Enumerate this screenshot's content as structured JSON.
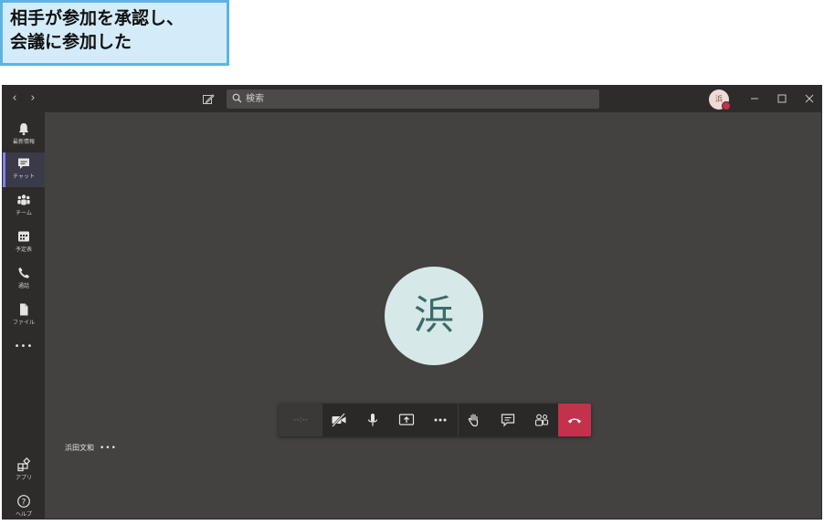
{
  "callout": {
    "line1": "相手が参加を承認し、",
    "line2": "会議に参加した"
  },
  "titlebar": {
    "back_icon": "‹",
    "forward_icon": "›",
    "search_placeholder": "検索",
    "avatar_initial": "浜",
    "status_color": "#c4314b"
  },
  "rail": {
    "items": [
      {
        "label": "最新情報",
        "icon": "bell-icon"
      },
      {
        "label": "チャット",
        "icon": "chat-icon"
      },
      {
        "label": "チーム",
        "icon": "teams-icon"
      },
      {
        "label": "予定表",
        "icon": "calendar-icon"
      },
      {
        "label": "通話",
        "icon": "phone-icon"
      },
      {
        "label": "ファイル",
        "icon": "file-icon"
      }
    ],
    "more": "•••",
    "apps_label": "アプリ",
    "help_label": "ヘルプ"
  },
  "call": {
    "avatar_initial": "浜",
    "timer": "--:--",
    "more_label": "•••",
    "participant_name": "浜田文和",
    "participant_more": "•••"
  },
  "colors": {
    "accent": "#7b83eb",
    "hangup": "#c4314b",
    "avatar_bg": "#d6e9e8",
    "callout_border": "#5bb4e2"
  }
}
